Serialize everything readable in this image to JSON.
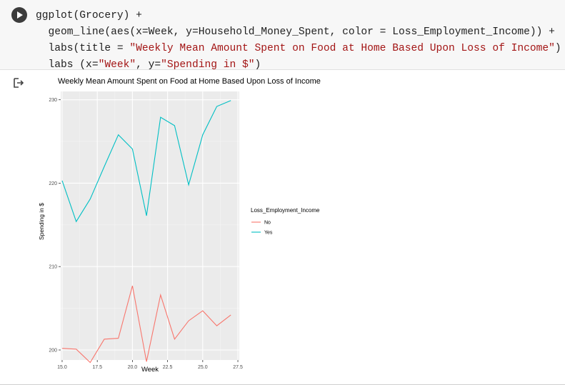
{
  "cell": {
    "code_lines": [
      "ggplot(Grocery) +",
      "  geom_line(aes(x=Week, y=Household_Money_Spent, color = Loss_Employment_Income)) +",
      "  labs(title = \"Weekly Mean Amount Spent on Food at Home Based Upon Loss of Income\") +",
      "  labs (x=\"Week\", y=\"Spending in $\")"
    ]
  },
  "output": {
    "icon": "output-arrow-icon"
  },
  "colors": {
    "No": "#F8766D",
    "Yes": "#00BFC4",
    "panel": "#EBEBEB",
    "grid": "#FFFFFF"
  },
  "chart_data": {
    "type": "line",
    "title": "Weekly Mean Amount Spent on Food at Home Based Upon Loss of Income",
    "xlabel": "Week",
    "ylabel": "Spending in $",
    "xlim": [
      14.9,
      27.6
    ],
    "ylim": [
      198.8,
      231.0
    ],
    "x_ticks": [
      "15.0",
      "17.5",
      "20.0",
      "22.5",
      "25.0",
      "27.5"
    ],
    "x_tick_values": [
      15.0,
      17.5,
      20.0,
      22.5,
      25.0,
      27.5
    ],
    "y_ticks": [
      "200",
      "210",
      "220",
      "230"
    ],
    "y_tick_values": [
      200,
      210,
      220,
      230
    ],
    "legend_title": "Loss_Employment_Income",
    "legend_position": "right",
    "grid": true,
    "x": [
      15,
      16,
      17,
      18,
      19,
      20,
      21,
      22,
      23,
      24,
      25,
      26,
      27
    ],
    "series": [
      {
        "name": "No",
        "values": [
          200.2,
          200.1,
          198.5,
          201.3,
          201.4,
          207.7,
          198.6,
          206.6,
          201.3,
          203.5,
          204.7,
          202.9,
          204.2
        ]
      },
      {
        "name": "Yes",
        "values": [
          220.3,
          215.4,
          218.1,
          222.0,
          225.8,
          224.1,
          216.1,
          227.9,
          226.9,
          219.8,
          225.8,
          229.2,
          229.9
        ]
      }
    ]
  }
}
